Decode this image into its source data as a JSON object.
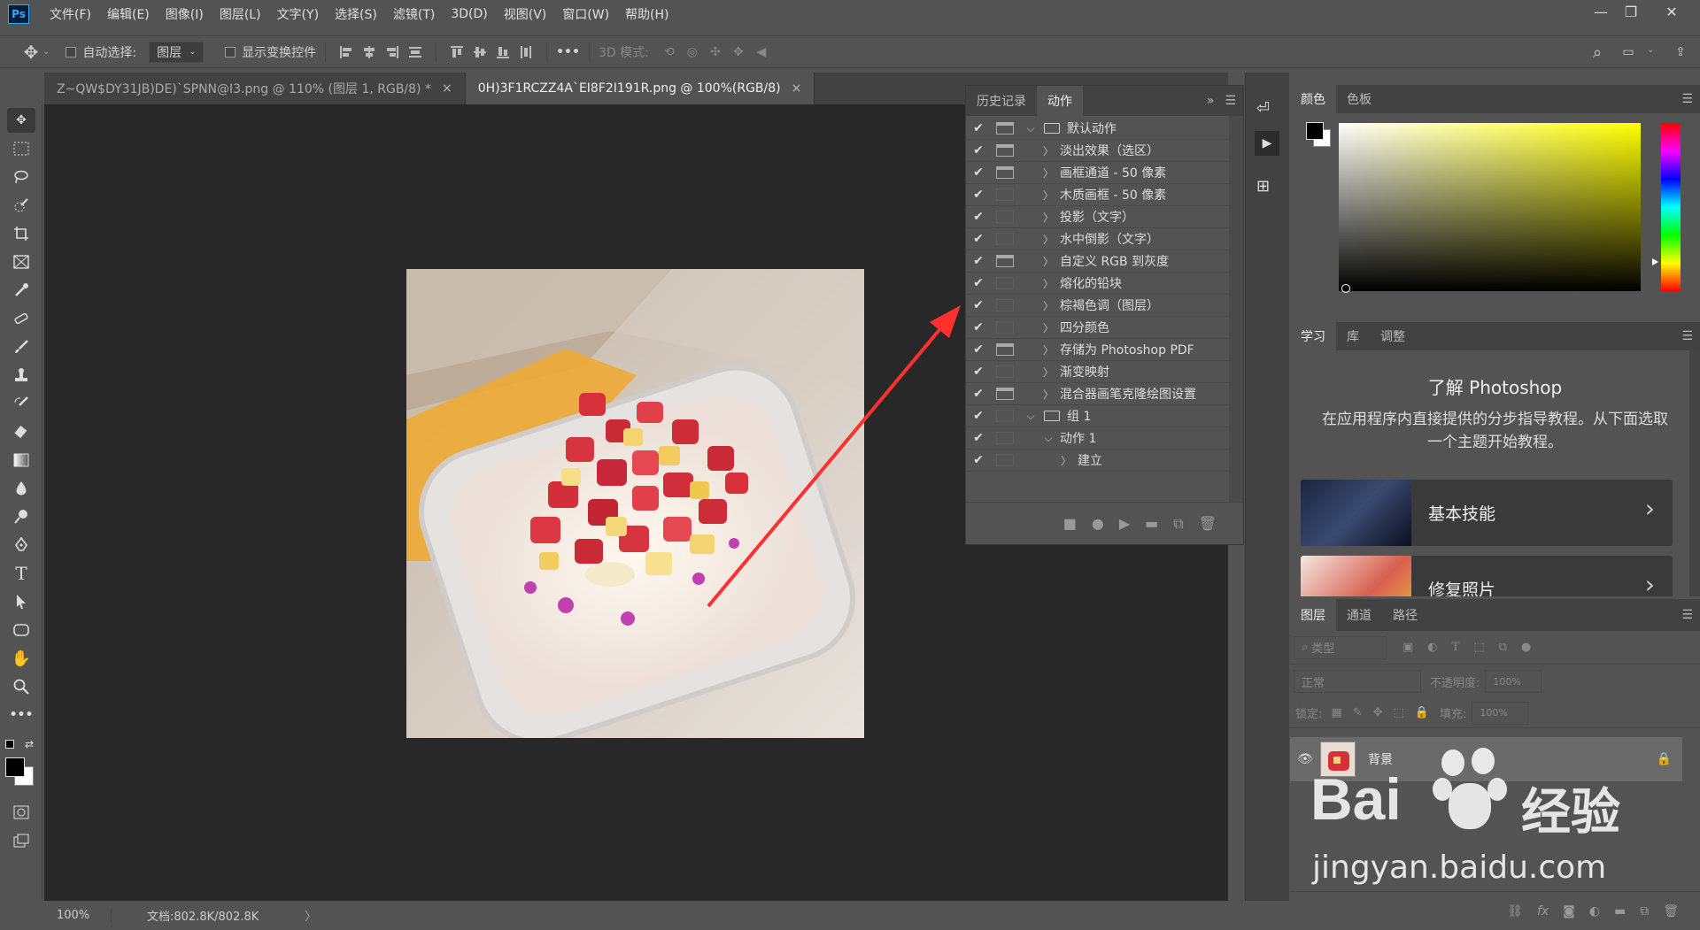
{
  "menu": {
    "app_logo": "Ps",
    "items": [
      "文件(F)",
      "编辑(E)",
      "图像(I)",
      "图层(L)",
      "文字(Y)",
      "选择(S)",
      "滤镜(T)",
      "3D(D)",
      "视图(V)",
      "窗口(W)",
      "帮助(H)"
    ]
  },
  "options": {
    "auto_select_label": "自动选择:",
    "auto_select_value": "图层",
    "show_transform_label": "显示变换控件",
    "mode_3d_label": "3D 模式:",
    "more": "•••"
  },
  "tabs": [
    {
      "label": "Z~QW$DY31JB)DE)`SPNN@I3.png @ 110% (图层 1, RGB/8) *",
      "close": "×"
    },
    {
      "label": "0H)3F1RCZZ4A`EI8F2I191R.png @ 100%(RGB/8)",
      "close": "×"
    }
  ],
  "status": {
    "zoom": "100%",
    "doc": "文档:802.8K/802.8K",
    "arrow": "〉"
  },
  "actions_panel": {
    "tabs": [
      "历史记录",
      "动作"
    ],
    "expand": "»",
    "items": [
      {
        "label": "默认动作",
        "level": 0,
        "folder": true,
        "open": true,
        "dialog": true
      },
      {
        "label": "淡出效果（选区）",
        "level": 1,
        "dialog": true
      },
      {
        "label": "画框通道 - 50 像素",
        "level": 1,
        "dialog": true
      },
      {
        "label": "木质画框 - 50 像素",
        "level": 1,
        "dialog": false
      },
      {
        "label": "投影（文字）",
        "level": 1,
        "dialog": false
      },
      {
        "label": "水中倒影（文字）",
        "level": 1,
        "dialog": false
      },
      {
        "label": "自定义 RGB 到灰度",
        "level": 1,
        "dialog": true
      },
      {
        "label": "熔化的铅块",
        "level": 1,
        "dialog": false
      },
      {
        "label": "棕褐色调（图层）",
        "level": 1,
        "dialog": false
      },
      {
        "label": "四分颜色",
        "level": 1,
        "dialog": false
      },
      {
        "label": "存储为 Photoshop PDF",
        "level": 1,
        "dialog": true
      },
      {
        "label": "渐变映射",
        "level": 1,
        "dialog": false
      },
      {
        "label": "混合器画笔克隆绘图设置",
        "level": 1,
        "dialog": true
      },
      {
        "label": "组 1",
        "level": 0,
        "folder": true,
        "open": true,
        "dialog": false
      },
      {
        "label": "动作 1",
        "level": 1,
        "open": true,
        "dialog": false
      },
      {
        "label": "建立",
        "level": 2,
        "dialog": false
      }
    ],
    "check": "✔",
    "footer_icons": [
      "stop-icon",
      "record-icon",
      "play-icon",
      "new-set-icon",
      "new-action-icon",
      "delete-icon"
    ]
  },
  "color_panel": {
    "tabs": [
      "颜色",
      "色板"
    ]
  },
  "learn_panel": {
    "tabs": [
      "学习",
      "库",
      "调整"
    ],
    "title": "了解 Photoshop",
    "desc": "在应用程序内直接提供的分步指导教程。从下面选取一个主题开始教程。",
    "cards": [
      {
        "label": "基本技能"
      },
      {
        "label": "修复照片"
      }
    ],
    "chevron": "›"
  },
  "layers_panel": {
    "tabs": [
      "图层",
      "通道",
      "路径"
    ],
    "filter_label": "类型",
    "blend_mode": "正常",
    "opacity_label": "不透明度:",
    "opacity_value": "100%",
    "lock_label": "锁定:",
    "fill_label": "填充:",
    "fill_value": "100%",
    "layers": [
      {
        "name": "背景",
        "visible": true,
        "locked": true
      }
    ]
  },
  "watermark": {
    "brand": "Bai",
    "brand2": "经验",
    "url": "jingyan.baidu.com"
  },
  "colors": {
    "accent": "#31a8ff",
    "arrow": "#ff3030",
    "bg": "#535353",
    "canvas_bg": "#282828"
  }
}
